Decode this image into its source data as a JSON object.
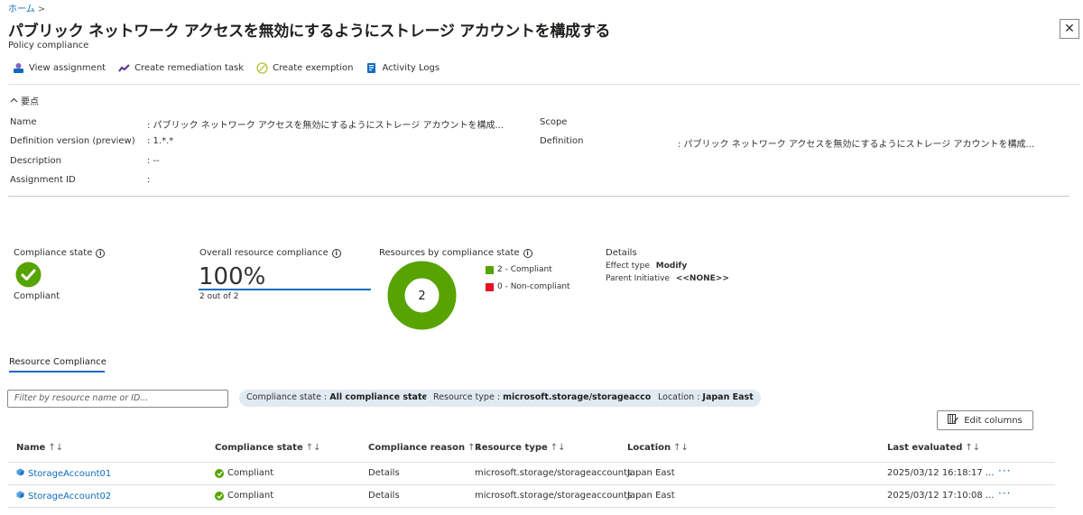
{
  "breadcrumb": {
    "home": "ホーム",
    "separator": ">"
  },
  "header": {
    "title": "パブリック ネットワーク アクセスを無効にするようにストレージ アカウントを構成する",
    "subtitle": "Policy compliance",
    "more": "···",
    "close": "✕"
  },
  "toolbar": {
    "view_assignment": "View assignment",
    "create_remediation": "Create remediation task",
    "create_exemption": "Create exemption",
    "activity_logs": "Activity Logs"
  },
  "essentials": {
    "toggle": "要点",
    "name_label": "Name",
    "name_value": ": パブリック ネットワーク アクセスを無効にするようにストレージ アカウントを構成...",
    "defver_label": "Definition version (preview)",
    "defver_value": ": 1.*.*",
    "desc_label": "Description",
    "desc_value": ": --",
    "assign_label": "Assignment ID",
    "assign_value": ":",
    "scope_label": "Scope",
    "def_label": "Definition",
    "def_value": ": パブリック ネットワーク アクセスを無効にするようにストレージ アカウントを構成..."
  },
  "summary": {
    "compliance_state_title": "Compliance state",
    "compliance_state_value": "Compliant",
    "overall_title": "Overall resource compliance",
    "overall_pct": "100%",
    "overall_fraction": 1.0,
    "overall_sub": "2 out of 2",
    "by_state_title": "Resources by compliance state",
    "donut_center": "2",
    "legend_compliant": "2 - Compliant",
    "legend_noncompliant": "0 - Non-compliant",
    "compliant_count": 2,
    "noncompliant_count": 0,
    "colors": {
      "compliant": "#57a300",
      "noncompliant": "#e81123",
      "accent": "#0f6cbd"
    },
    "details_title": "Details",
    "effect_label": "Effect type",
    "effect_value": "Modify",
    "parent_label": "Parent Initiative",
    "parent_value": "<<NONE>>"
  },
  "tabs": {
    "resource_compliance": "Resource Compliance"
  },
  "filters": {
    "search_placeholder": "Filter by resource name or ID...",
    "state_label": "Compliance state : ",
    "state_value": "All compliance states",
    "type_label": "Resource type : ",
    "type_value": "microsoft.storage/storageaccounts",
    "location_label": "Location : ",
    "location_value": "Japan East"
  },
  "edit_columns": "Edit columns",
  "table": {
    "headers": {
      "name": "Name",
      "state": "Compliance state",
      "reason": "Compliance reason",
      "type": "Resource type",
      "location": "Location",
      "evaluated": "Last evaluated",
      "sort": "↑↓"
    },
    "rows": [
      {
        "name": "StorageAccount01",
        "state": "Compliant",
        "reason": "Details",
        "type": "microsoft.storage/storageaccounts",
        "location": "Japan East",
        "evaluated": "2025/03/12 16:18:17 ...",
        "more": "···"
      },
      {
        "name": "StorageAccount02",
        "state": "Compliant",
        "reason": "Details",
        "type": "microsoft.storage/storageaccounts",
        "location": "Japan East",
        "evaluated": "2025/03/12 17:10:08 ...",
        "more": "···"
      }
    ]
  }
}
